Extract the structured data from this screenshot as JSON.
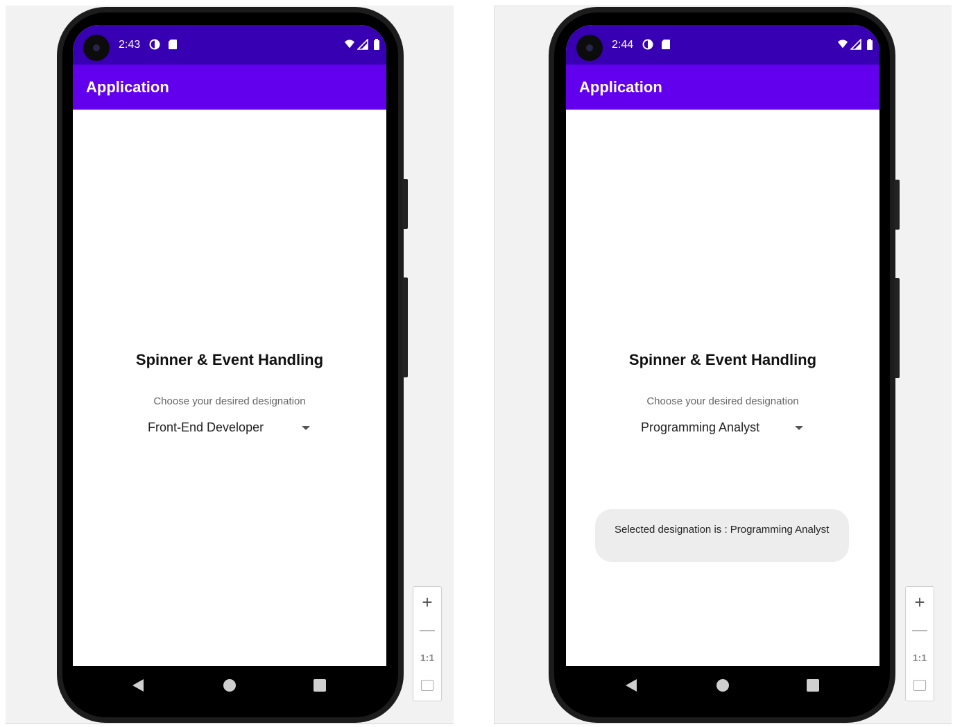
{
  "screens": [
    {
      "status": {
        "time": "2:43"
      },
      "app_bar": {
        "title": "Application"
      },
      "content": {
        "heading": "Spinner & Event Handling",
        "prompt": "Choose your desired designation",
        "selected_designation": "Front-End Developer"
      }
    },
    {
      "status": {
        "time": "2:44"
      },
      "app_bar": {
        "title": "Application"
      },
      "content": {
        "heading": "Spinner & Event Handling",
        "prompt": "Choose your desired designation",
        "selected_designation": "Programming Analyst"
      },
      "toast": {
        "message": "Selected designation is : Programming Analyst"
      }
    }
  ],
  "zoom_controls": {
    "plus": "+",
    "minus": "—",
    "actual_size": "1:1"
  },
  "colors": {
    "status_bar": "#3700b3",
    "app_bar": "#6200ee",
    "toast_bg": "#ededed"
  },
  "icons": [
    "data-saver-icon",
    "sd-card-icon",
    "wifi-icon",
    "signal-icon",
    "battery-icon",
    "back-nav-icon",
    "home-nav-icon",
    "recents-nav-icon",
    "zoom-in-icon",
    "zoom-out-icon",
    "zoom-fit-icon"
  ]
}
